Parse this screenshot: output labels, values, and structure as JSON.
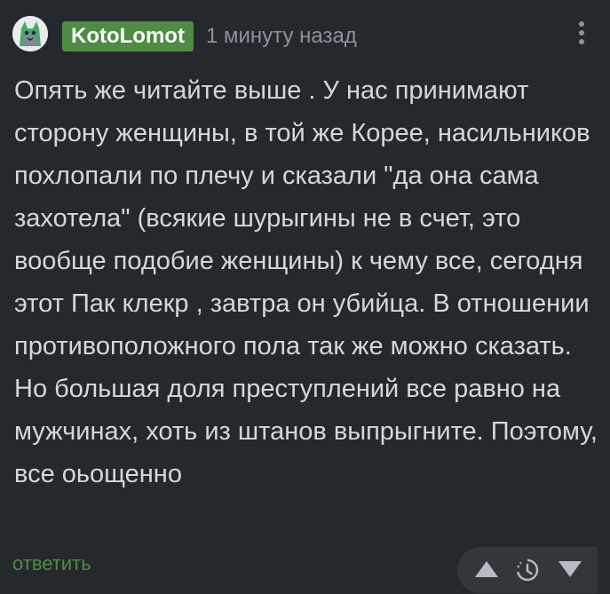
{
  "comment": {
    "author": "KotoLomot",
    "time": "1 минуту назад",
    "text": "Опять же читайте выше . У нас принимают сторону женщины, в той же Корее, насильников похлопали по плечу и сказали \"да она сама захотела\" (всякие шурыгины не в счет, это вообще подобие женщины) к чему все, сегодня этот Пак клекр , завтра он убийца. В отношении противоположного пола так же можно сказать. Но большая доля преступлений все равно на мужчинах, хоть из штанов выпрыгните. Поэтому, все оьощенно",
    "reply_label": "ответить"
  },
  "icons": {
    "avatar": "avatar-image",
    "more": "more-vertical-icon",
    "upvote": "arrow-up-icon",
    "rating": "timer-icon",
    "downvote": "arrow-down-icon"
  },
  "colors": {
    "background": "#25282c",
    "accent": "#4e8c43",
    "text": "#d4d8dc",
    "muted": "#8d939a",
    "vote_bg": "#33373c"
  }
}
